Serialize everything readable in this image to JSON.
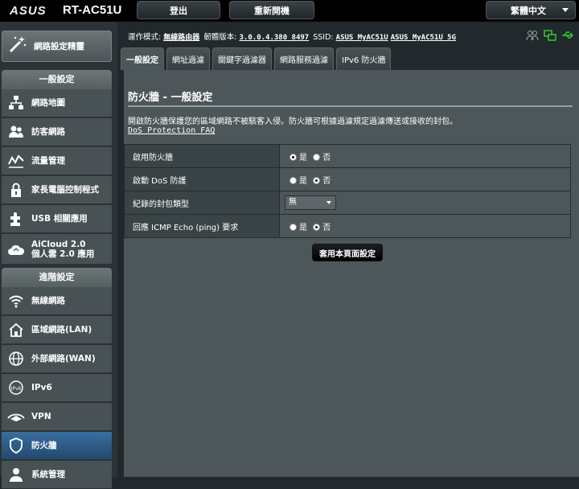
{
  "topbar": {
    "brand": "ASUS",
    "model": "RT-AC51U",
    "logout_label": "登出",
    "reboot_label": "重新開機",
    "language_label": "繁體中文"
  },
  "sidebar": {
    "quick_setup": "網路設定精靈",
    "general_header": "一般設定",
    "general_items": [
      {
        "label": "網路地圖",
        "icon": "network-map-icon"
      },
      {
        "label": "訪客網路",
        "icon": "guest-network-icon"
      },
      {
        "label": "流量管理",
        "icon": "traffic-manager-icon"
      },
      {
        "label": "家長電腦控制程式",
        "icon": "parental-control-icon"
      },
      {
        "label": "USB 相關應用",
        "icon": "usb-application-icon"
      },
      {
        "label": "AiCloud 2.0",
        "label2": "個人雲 2.0 應用",
        "icon": "aicloud-icon"
      }
    ],
    "advanced_header": "進階設定",
    "advanced_items": [
      {
        "label": "無線網路",
        "icon": "wireless-icon"
      },
      {
        "label": "區域網路(LAN)",
        "icon": "lan-icon"
      },
      {
        "label": "外部網路(WAN)",
        "icon": "wan-icon"
      },
      {
        "label": "IPv6",
        "icon": "ipv6-icon"
      },
      {
        "label": "VPN",
        "icon": "vpn-icon"
      },
      {
        "label": "防火牆",
        "icon": "firewall-icon"
      },
      {
        "label": "系統管理",
        "icon": "administration-icon"
      }
    ]
  },
  "status": {
    "mode_label": "運作模式:",
    "mode_value": "無線路由器",
    "firmware_label": "韌體版本:",
    "firmware_value": "3.0.0.4.380_8497",
    "ssid_label": "SSID:",
    "ssid_1": "ASUS_MyAC51U",
    "ssid_2": "ASUS_MyAC51U_5G"
  },
  "tabs": [
    {
      "label": "一般設定"
    },
    {
      "label": "網址過濾"
    },
    {
      "label": "關鍵字過濾器"
    },
    {
      "label": "網路服務過濾"
    },
    {
      "label": "IPv6 防火牆"
    }
  ],
  "panel": {
    "title": "防火牆 - 一般設定",
    "description": "開啟防火牆保護您的區域網路不被駭客入侵。防火牆可根據過濾規定過濾傳送或接收的封包。",
    "faq_link": "DoS Protection FAQ",
    "rows": [
      {
        "label": "啟用防火牆",
        "yes": "是",
        "no": "否",
        "selected": "yes"
      },
      {
        "label": "啟動 DoS 防護",
        "yes": "是",
        "no": "否",
        "selected": "no"
      },
      {
        "label": "紀錄的封包類型",
        "select_value": "無"
      },
      {
        "label": "回應 ICMP Echo (ping) 要求",
        "yes": "是",
        "no": "否",
        "selected": "no"
      }
    ],
    "apply_label": "套用本頁面設定"
  }
}
